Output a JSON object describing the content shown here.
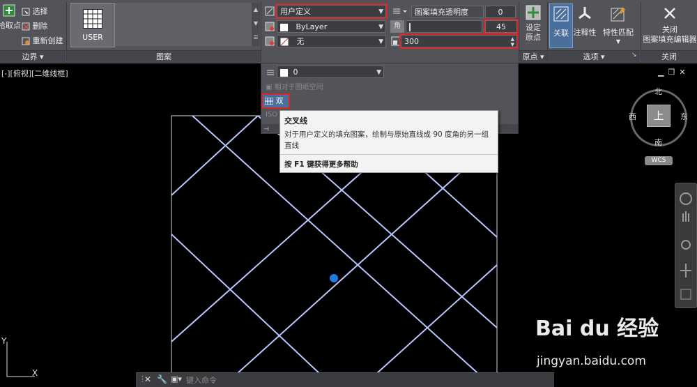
{
  "ribbon": {
    "boundary": {
      "pick_points": "拾取点",
      "select": "选择",
      "remove": "删除",
      "recreate": "重新创建",
      "title": "边界 ▾"
    },
    "pattern": {
      "swatch_label": "USER",
      "title": "图案"
    },
    "properties": {
      "pattern_type": "用户定义",
      "color": "ByLayer",
      "background": "无",
      "transparency_label": "图案填充透明度",
      "transparency_value": "0",
      "angle_label": "角度",
      "angle_value": "45",
      "spacing_value": "300",
      "layer_value": "0",
      "relative_paper": "相对于图纸空间",
      "double_label": "双",
      "iso_label": "ISO"
    },
    "origin": {
      "set_origin": "设定\n原点",
      "title": "原点 ▾"
    },
    "options": {
      "associative": "关联",
      "annotative": "注释性",
      "match_props": "特性匹配",
      "title": "选项 ▾"
    },
    "close": {
      "label": "关闭\n图案填充编辑器",
      "title": "关闭"
    }
  },
  "tooltip": {
    "title": "交叉线",
    "body": "对于用户定义的填充图案，绘制与原始直线成 90 度角的另一组直线",
    "help": "按 F1 键获得更多帮助"
  },
  "viewport": {
    "label": "[-][俯视][二维线框]"
  },
  "viewcube": {
    "north": "北",
    "south": "南",
    "east": "东",
    "west": "西",
    "top": "上",
    "wcs": "WCS"
  },
  "command": {
    "placeholder": "键入命令"
  },
  "axis": {
    "y": "Y",
    "x": "X"
  },
  "watermark": {
    "brand": "Bai du 经验",
    "url": "jingyan.baidu.com"
  },
  "colors": {
    "accent_red": "#d8262a",
    "hatch_line": "#b9c8ff",
    "ribbon_bg": "#535459",
    "blue_dot": "#1f7be0"
  }
}
